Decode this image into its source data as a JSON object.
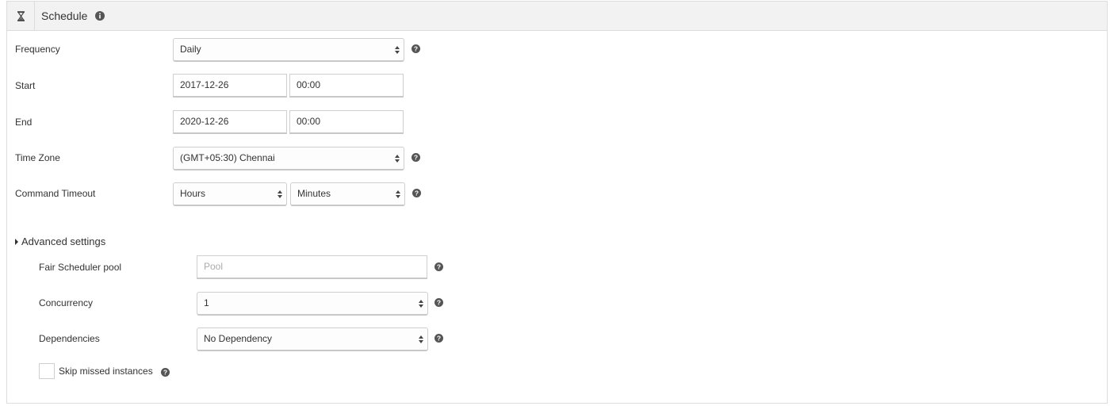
{
  "header": {
    "title": "Schedule",
    "icon": "hourglass-icon",
    "info_icon": "info-icon"
  },
  "form": {
    "frequency": {
      "label": "Frequency",
      "value": "Daily"
    },
    "start": {
      "label": "Start",
      "date": "2017-12-26",
      "time": "00:00"
    },
    "end": {
      "label": "End",
      "date": "2020-12-26",
      "time": "00:00"
    },
    "timezone": {
      "label": "Time Zone",
      "value": "(GMT+05:30) Chennai"
    },
    "command_timeout": {
      "label": "Command Timeout",
      "hours": "Hours",
      "minutes": "Minutes"
    }
  },
  "advanced": {
    "toggle_label": "Advanced settings",
    "pool": {
      "label": "Fair Scheduler pool",
      "placeholder": "Pool"
    },
    "concurrency": {
      "label": "Concurrency",
      "value": "1"
    },
    "dependencies": {
      "label": "Dependencies",
      "value": "No Dependency"
    },
    "skip_missed": {
      "label": "Skip missed instances",
      "checked": false
    }
  }
}
